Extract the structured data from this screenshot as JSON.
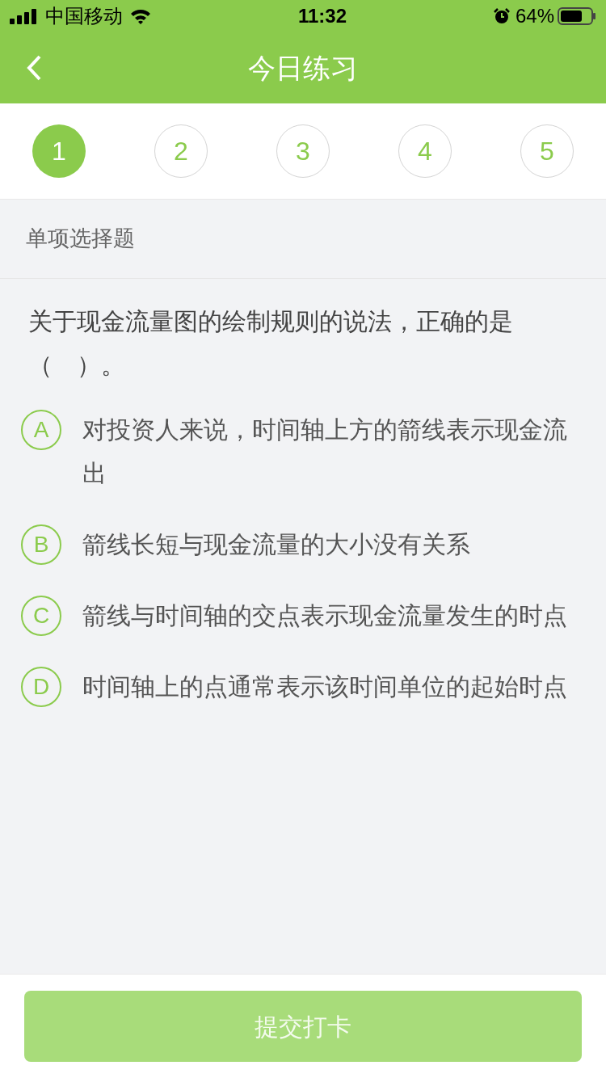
{
  "status_bar": {
    "carrier": "中国移动",
    "time": "11:32",
    "battery": "64%"
  },
  "header": {
    "title": "今日练习"
  },
  "steps": [
    {
      "label": "1",
      "selected": true
    },
    {
      "label": "2",
      "selected": false
    },
    {
      "label": "3",
      "selected": false
    },
    {
      "label": "4",
      "selected": false
    },
    {
      "label": "5",
      "selected": false
    }
  ],
  "section_title": "单项选择题",
  "question": "关于现金流量图的绘制规则的说法，正确的是（　）。",
  "options": [
    {
      "letter": "A",
      "text": "对投资人来说，时间轴上方的箭线表示现金流出",
      "selected": false
    },
    {
      "letter": "B",
      "text": "箭线长短与现金流量的大小没有关系",
      "selected": false
    },
    {
      "letter": "C",
      "text": "箭线与时间轴的交点表示现金流量发生的时点",
      "selected": false
    },
    {
      "letter": "D",
      "text": "时间轴上的点通常表示该时间单位的起始时点",
      "selected": false
    }
  ],
  "submit_button": {
    "label": "提交打卡",
    "disabled": true
  }
}
